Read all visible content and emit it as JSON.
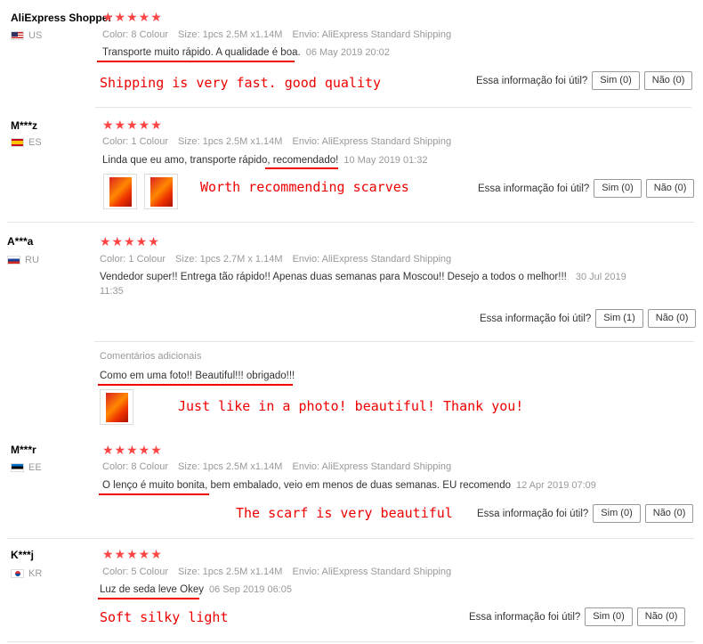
{
  "labels": {
    "color": "Color:",
    "size": "Size:",
    "ship": "Envio:",
    "helpful_q": "Essa informação foi útil?"
  },
  "reviews": [
    {
      "name": "AliExpress Shopper",
      "country": "US",
      "stars": "★★★★★",
      "color": "8 Colour",
      "size": "1pcs 2.5M x1.14M",
      "ship": "AliExpress Standard Shipping",
      "text": "Transporte muito rápido. A qualidade é boa.",
      "date": "06 May 2019 20:02",
      "annotation": "Shipping is very fast. good quality",
      "yes": "Sim (0)",
      "no": "Não (0)"
    },
    {
      "name": "M***z",
      "country": "ES",
      "stars": "★★★★★",
      "color": "1 Colour",
      "size": "1pcs 2.5M x1.14M",
      "ship": "AliExpress Standard Shipping",
      "text_a": "Linda que eu amo, transporte rápido, ",
      "text_b": "recomendado!",
      "date": "10 May 2019 01:32",
      "annotation": "Worth recommending scarves",
      "yes": "Sim (0)",
      "no": "Não (0)"
    },
    {
      "name": "A***a",
      "country": "RU",
      "stars": "★★★★★",
      "color": "1 Colour",
      "size": "1pcs 2.7M x 1.14M",
      "ship": "AliExpress Standard Shipping",
      "text": "Vendedor super!! Entrega tão rápido!! Apenas duas semanas para Moscou!! Desejo a todos o melhor!!!",
      "date_a": "30 Jul 2019",
      "date_b": "11:35",
      "yes": "Sim (1)",
      "no": "Não (0)",
      "additional_title": "Comentários adicionais",
      "additional_text": "Como em uma foto!! Beautiful!!! obrigado!!!",
      "annotation": "Just like in a photo! beautiful! Thank you!"
    },
    {
      "name": "M***r",
      "country": "EE",
      "stars": "★★★★★",
      "color": "8 Colour",
      "size": "1pcs 2.5M x1.14M",
      "ship": "AliExpress Standard Shipping",
      "text_a": "O lenço é muito bonita",
      "text_b": ", bem embalado, veio em menos de duas semanas. EU recomendo",
      "date": "12 Apr 2019 07:09",
      "annotation": "The scarf is very beautiful",
      "yes": "Sim (0)",
      "no": "Não (0)"
    },
    {
      "name": "K***j",
      "country": "KR",
      "stars": "★★★★★",
      "color": "5 Colour",
      "size": "1pcs 2.5M x1.14M",
      "ship": "AliExpress Standard Shipping",
      "text": "Luz de seda leve Okey",
      "date": "06 Sep 2019 06:05",
      "annotation": "Soft silky light",
      "yes": "Sim (0)",
      "no": "Não (0)"
    }
  ]
}
